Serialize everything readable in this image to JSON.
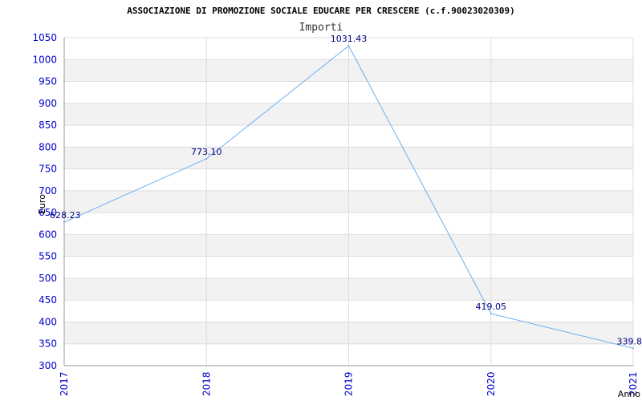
{
  "chart_data": {
    "type": "line",
    "title": "ASSOCIAZIONE DI PROMOZIONE SOCIALE EDUCARE PER CRESCERE (c.f.90023020309)",
    "subtitle": "Importi",
    "xlabel": "Anno",
    "ylabel": "Euro",
    "categories": [
      "2017",
      "2018",
      "2019",
      "2020",
      "2021"
    ],
    "series": [
      {
        "values": [
          628.23,
          773.1,
          1031.43,
          419.05,
          339.8
        ],
        "labels": [
          "628.23",
          "773.10",
          "1031.43",
          "419.05",
          "339.8"
        ]
      }
    ],
    "ylim": [
      300,
      1050
    ],
    "yticks": [
      "300",
      "350",
      "400",
      "450",
      "500",
      "550",
      "600",
      "650",
      "700",
      "750",
      "800",
      "850",
      "900",
      "950",
      "1000",
      "1050"
    ],
    "grid": true,
    "colors": {
      "line": "#6aaef0",
      "tick_text": "#0000cc",
      "band": "#f2f2f2",
      "gridline": "#dddddd",
      "title": "#000000"
    }
  }
}
